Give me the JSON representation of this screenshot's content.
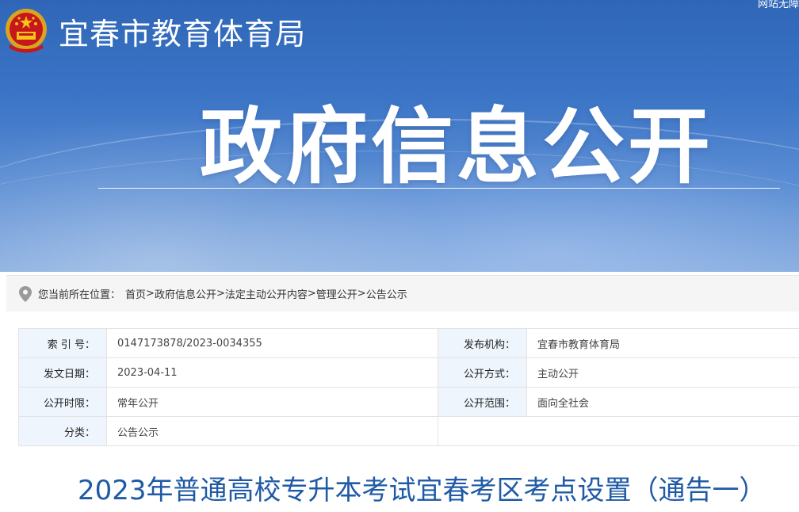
{
  "header": {
    "site_title": "宜春市教育体育局",
    "corner_text": "网站无障",
    "banner_title": "政府信息公开"
  },
  "breadcrumb": {
    "prefix": "您当前所在位置：",
    "items": [
      "首页",
      "政府信息公开",
      "法定主动公开内容",
      "管理公开",
      "公告公示"
    ],
    "separator": ">"
  },
  "meta": {
    "index_label": "索 引 号：",
    "index_value": "0147173878/2023-0034355",
    "publisher_label": "发布机构：",
    "publisher_value": "宜春市教育体育局",
    "date_label": "发文日期：",
    "date_value": "2023-04-11",
    "mode_label": "公开方式：",
    "mode_value": "主动公开",
    "period_label": "公开时限：",
    "period_value": "常年公开",
    "scope_label": "公开范围：",
    "scope_value": "面向全社会",
    "category_label": "分类：",
    "category_value": "公告公示"
  },
  "article": {
    "title": "2023年普通高校专升本考试宜春考区考点设置（通告一）"
  },
  "colors": {
    "banner_blue": "#3b74c6",
    "label_bg": "#eef5fd",
    "title_blue": "#1f5aa6"
  }
}
